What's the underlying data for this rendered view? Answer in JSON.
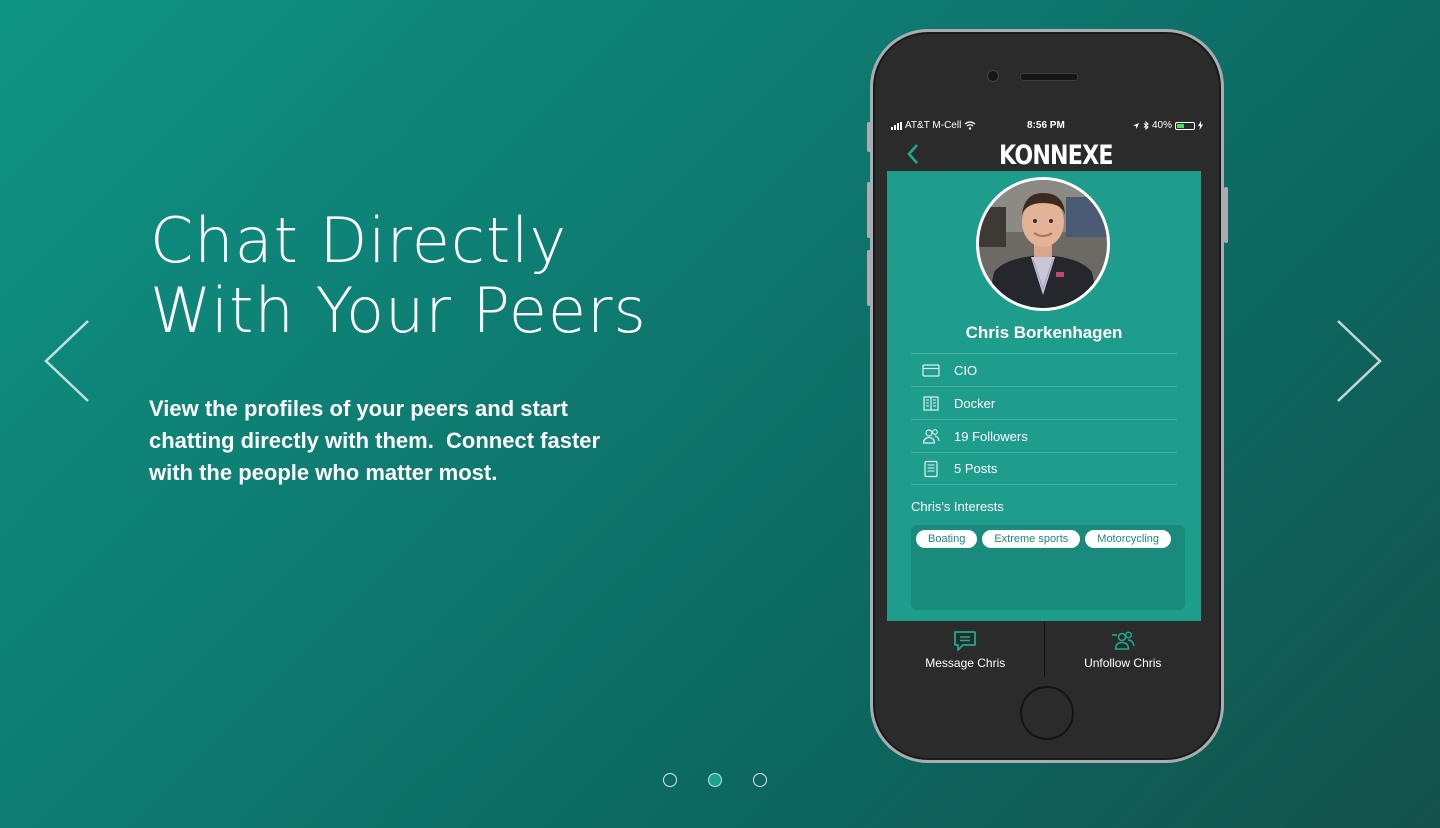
{
  "hero": {
    "headline_line1": "Chat Directly",
    "headline_line2": "With Your Peers",
    "sub_line1": "View the profiles of your peers and start",
    "sub_line2": "chatting directly with them.  Connect faster",
    "sub_line3": "with the people who matter most."
  },
  "carousel": {
    "prev_icon": "chevron-left-icon",
    "next_icon": "chevron-right-icon",
    "dots": 3,
    "active_index": 1
  },
  "phone": {
    "status": {
      "carrier": "AT&T M-Cell",
      "time": "8:56 PM",
      "battery": "40%"
    },
    "app_logo": "KONNEXE",
    "profile": {
      "name": "Chris Borkenhagen",
      "details": [
        {
          "icon": "id-card-icon",
          "text": "CIO"
        },
        {
          "icon": "building-icon",
          "text": "Docker"
        },
        {
          "icon": "followers-icon",
          "text": "19 Followers"
        },
        {
          "icon": "posts-icon",
          "text": "5 Posts"
        }
      ],
      "interests_title": "Chris's Interests",
      "interests": [
        "Boating",
        "Extreme sports",
        "Motorcycling"
      ]
    },
    "actions": {
      "message": "Message Chris",
      "unfollow": "Unfollow Chris"
    }
  },
  "colors": {
    "background": "#0e7a70",
    "screen": "#1e9d8c",
    "interests_box": "#198a7b",
    "phone_body": "#2b2b2b",
    "accent": "#1aa58f"
  }
}
